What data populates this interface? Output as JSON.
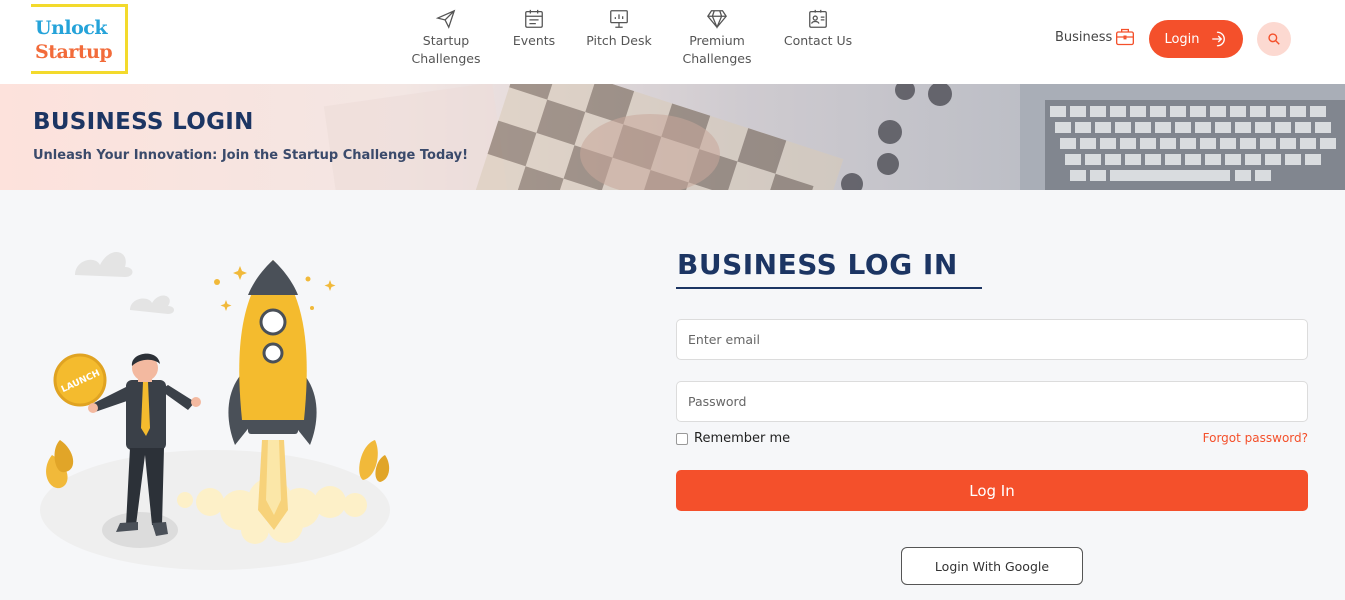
{
  "logo": {
    "line1": "Unlock",
    "line2": "Startup"
  },
  "nav": [
    {
      "label": "Startup\nChallenges",
      "icon": "paper-plane-icon"
    },
    {
      "label": "Events",
      "icon": "calendar-icon"
    },
    {
      "label": "Pitch Desk",
      "icon": "presentation-board-icon"
    },
    {
      "label": "Premium\nChallenges",
      "icon": "diamond-icon"
    },
    {
      "label": "Contact Us",
      "icon": "contact-card-icon"
    }
  ],
  "header": {
    "business_label": "Business",
    "login_label": "Login"
  },
  "banner": {
    "title": "BUSINESS LOGIN",
    "subtitle": "Unleash Your Innovation: Join the Startup Challenge Today!"
  },
  "form": {
    "title": "BUSINESS LOG IN",
    "email_placeholder": "Enter email",
    "password_placeholder": "Password",
    "remember_label": "Remember me",
    "forgot_label": "Forgot password?",
    "submit_label": "Log In",
    "google_label": "Login With Google"
  },
  "illustration": {
    "badge_text": "LAUNCH"
  },
  "colors": {
    "accent": "#f4502b",
    "navy": "#1c3563",
    "logo_blue": "#25a3d9",
    "logo_orange": "#f26b3a",
    "logo_frame": "#f3da2c"
  }
}
